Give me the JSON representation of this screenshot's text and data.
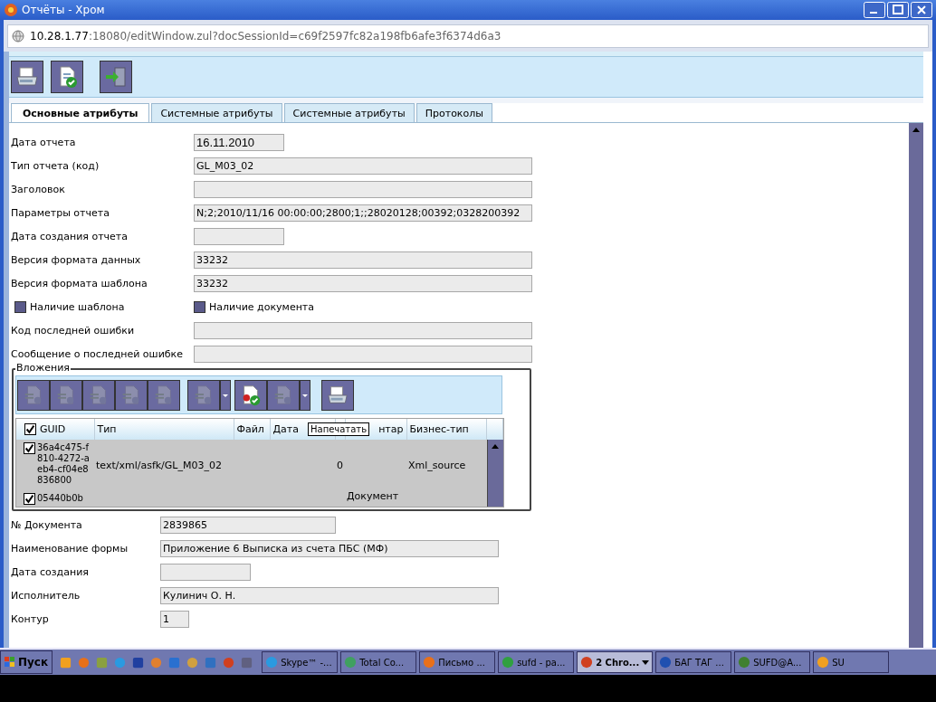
{
  "window": {
    "title": "Отчёты - Хром"
  },
  "address": {
    "host": "10.28.1.77",
    "rest": ":18080/editWindow.zul?docSessionId=c69f2597fc82a198fb6afe3f6374d6a3"
  },
  "tabs": [
    {
      "label": "Основные атрибуты",
      "selected": true
    },
    {
      "label": "Системные атрибуты",
      "selected": false
    },
    {
      "label": "Системные атрибуты",
      "selected": false
    },
    {
      "label": "Протоколы",
      "selected": false
    }
  ],
  "fields": [
    {
      "kind": "short",
      "label": "Дата отчета",
      "value": "16.11.2010"
    },
    {
      "kind": "long",
      "label": "Тип отчета (код)",
      "value": "GL_M03_02"
    },
    {
      "kind": "long",
      "label": "Заголовок"
    },
    {
      "kind": "long",
      "label": "Параметры отчета",
      "value": "N;2;2010/11/16 00:00:00;2800;1;;28020128;00392;0328200392"
    },
    {
      "kind": "short",
      "label": "Дата создания отчета"
    },
    {
      "kind": "long",
      "label": "Версия формата данных",
      "value": "33232"
    },
    {
      "kind": "long",
      "label": "Версия формата шаблона",
      "value": "33232"
    },
    {
      "kind": "checks",
      "items": [
        {
          "label": "Наличие шаблона",
          "checked": false
        },
        {
          "label": "Наличие документа",
          "checked": false
        }
      ]
    },
    {
      "kind": "long",
      "label": "Код последней ошибки"
    },
    {
      "kind": "long",
      "label": "Сообщение о последней ошибке"
    }
  ],
  "attachments": {
    "title": "Вложения",
    "buttons": [
      {
        "disabled": true,
        "dropdown": false
      },
      {
        "disabled": true,
        "dropdown": false
      },
      {
        "disabled": true,
        "dropdown": false
      },
      {
        "disabled": true,
        "dropdown": false
      },
      {
        "disabled": true,
        "dropdown": false
      },
      {
        "disabled": true,
        "dropdown": true
      },
      {
        "disabled": false,
        "dropdown": false
      },
      {
        "disabled": true,
        "dropdown": true
      },
      {
        "disabled": false,
        "dropdown": false
      }
    ],
    "header_checked": true,
    "columns": [
      "GUID",
      "Тип",
      "Файл",
      "Дата",
      "нтар",
      "Бизнес-тип"
    ],
    "rows": [
      {
        "checked": true,
        "guid": "36a4c475-f810-4272-aeb4-cf04e8836800",
        "type": "text/xml/asfk/GL_M03_02",
        "column_5": "0",
        "business_type": "Xml_source"
      },
      {
        "checked": true,
        "guid": "05440b0b",
        "comment": "Документ"
      }
    ],
    "tooltip": "Напечатать"
  },
  "document_fields": [
    {
      "kind": "mid",
      "label": "№ Документа",
      "value": "2839865"
    },
    {
      "kind": "long",
      "label": "Наименование формы",
      "value": "Приложение 6 Выписка из счета ПБС (МФ)"
    },
    {
      "kind": "short",
      "label": "Дата создания"
    },
    {
      "kind": "long",
      "label": "Исполнитель",
      "value": "Кулинич О. Н."
    },
    {
      "kind": "tiny",
      "label": "Контур",
      "value": "1"
    }
  ],
  "taskbar": {
    "start": "Пуск",
    "tasks": [
      {
        "label": "Skype™ -...",
        "selected": false
      },
      {
        "label": "Total Co...",
        "selected": false
      },
      {
        "label": "Письмо ...",
        "selected": false
      },
      {
        "label": "sufd - pa...",
        "selected": false
      },
      {
        "label": "2 Chro...",
        "selected": true
      },
      {
        "label": "БАГ ТАГ ...",
        "selected": false
      },
      {
        "label": "SUFD@A...",
        "selected": false
      },
      {
        "label": "SU",
        "selected": false
      }
    ]
  }
}
